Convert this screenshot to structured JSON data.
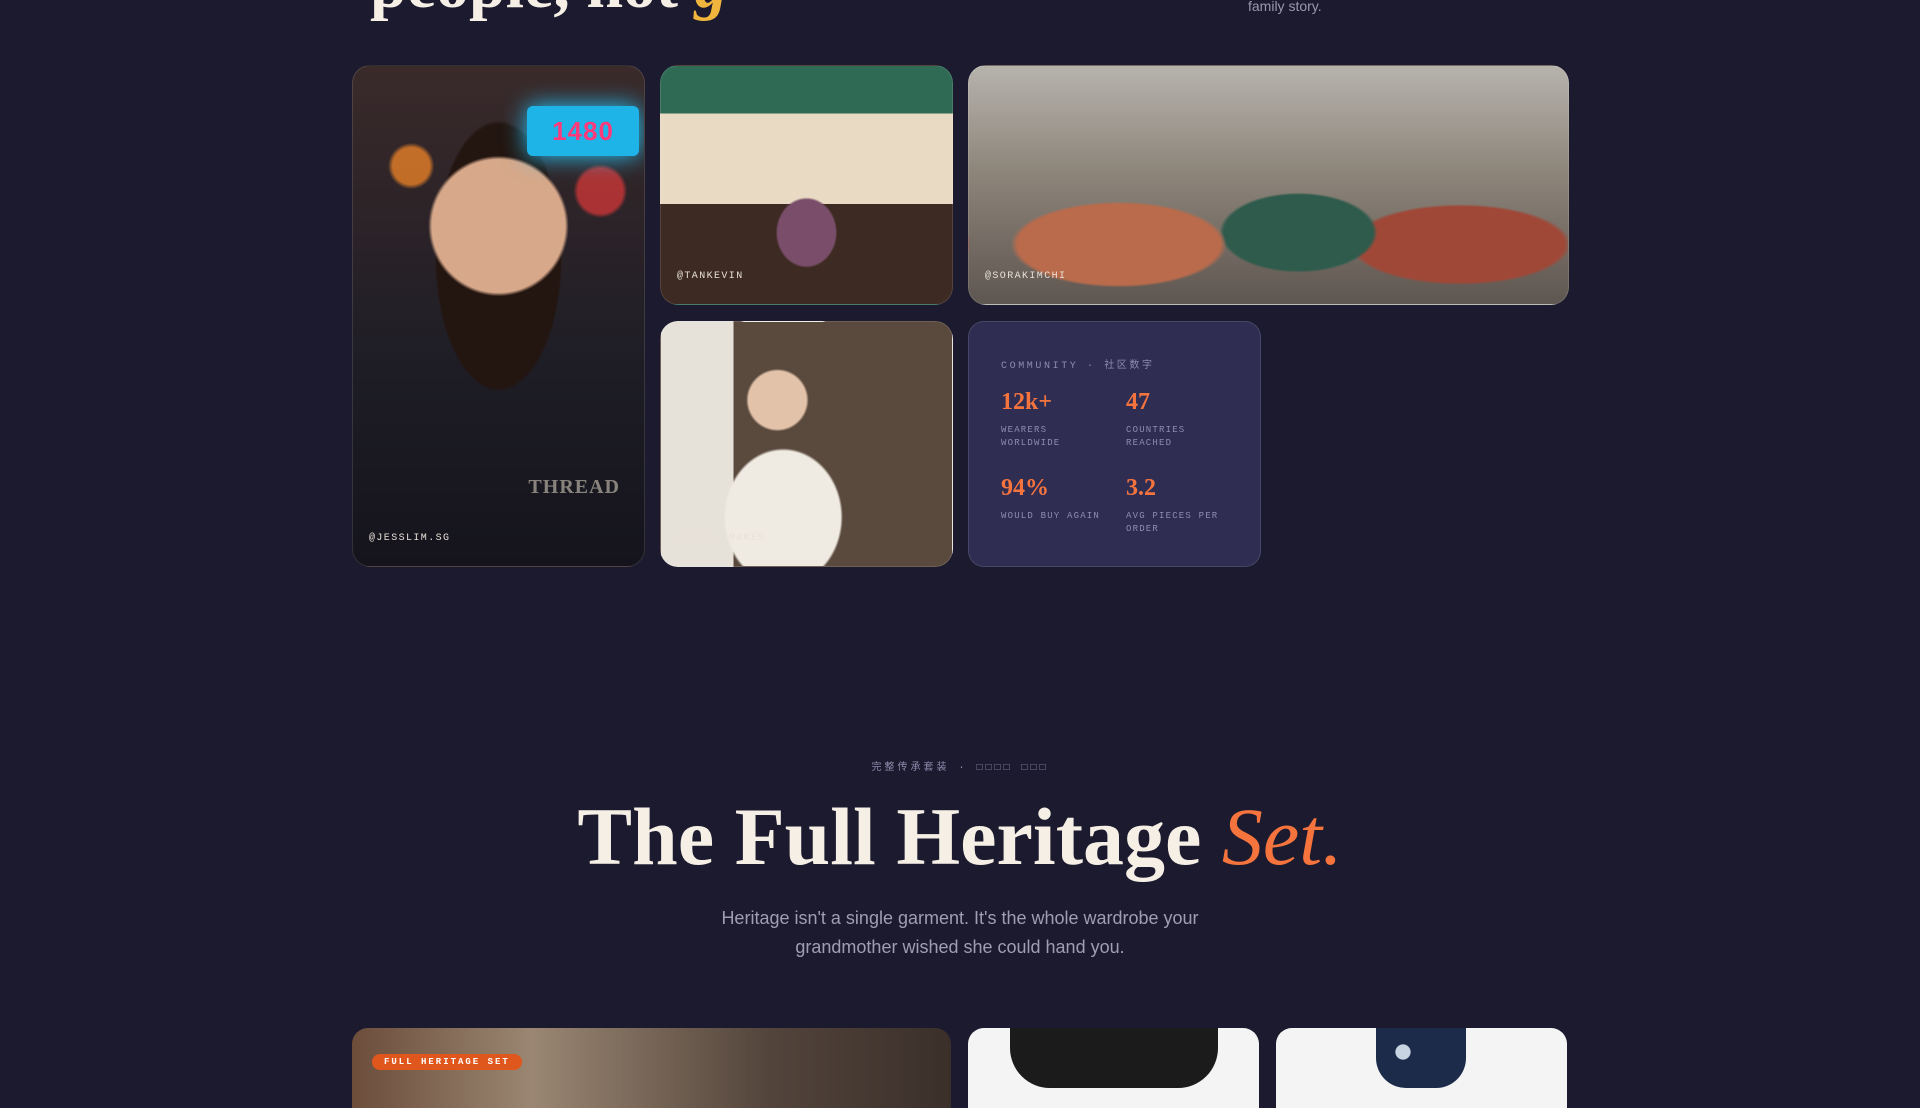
{
  "top": {
    "headline_main": "people, not",
    "headline_accent": "g",
    "note": "family story."
  },
  "community": {
    "cards": [
      {
        "handle": "@JESSLIM.SG",
        "sign_text": "1480",
        "watermark": "THREAD"
      },
      {
        "handle": "@TANKEVIN"
      },
      {
        "handle": "@SORAKIMCHI"
      },
      {
        "handle": "@PRIYA.MAKES"
      }
    ],
    "stats": {
      "label": "COMMUNITY · 社区数字",
      "items": [
        {
          "value": "12k+",
          "caption": "WEARERS WORLDWIDE"
        },
        {
          "value": "47",
          "caption": "COUNTRIES REACHED"
        },
        {
          "value": "94%",
          "caption": "WOULD BUY AGAIN"
        },
        {
          "value": "3.2",
          "caption": "AVG PIECES PER ORDER"
        }
      ]
    }
  },
  "heritage": {
    "eyebrow": "完整传承套装 · □□□□ □□□",
    "title_main": "The Full Heritage",
    "title_accent": "Set.",
    "subtitle": "Heritage isn't a single garment. It's the whole wardrobe your grandmother wished she could hand you.",
    "badge": "FULL HERITAGE SET"
  },
  "colors": {
    "background": "#1b1a2e",
    "accent_orange": "#f5743e",
    "accent_gold": "#f0b53c",
    "stats_card": "#2f2d52"
  }
}
